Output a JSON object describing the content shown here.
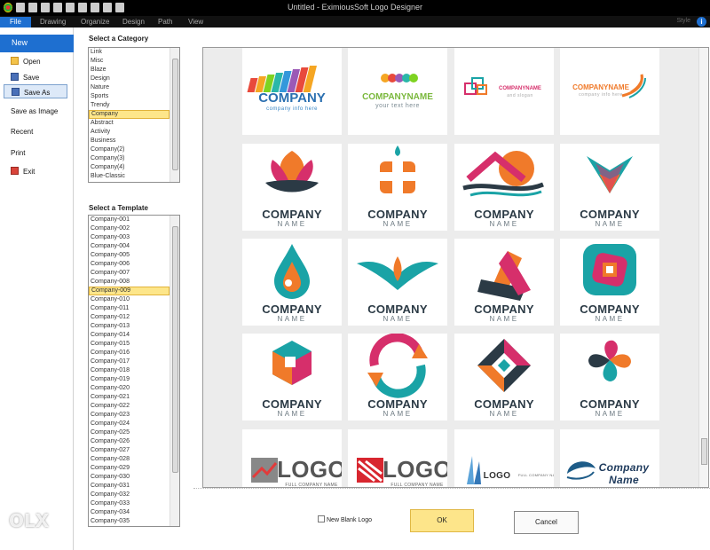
{
  "window": {
    "title": "Untitled - EximiousSoft Logo Designer"
  },
  "menu": {
    "tabs": [
      "File",
      "Drawing",
      "Organize",
      "Design",
      "Path",
      "View"
    ],
    "style": "Style",
    "help": "i"
  },
  "sidebar": {
    "new": "New",
    "items": [
      {
        "label": "Open",
        "icon": "folder-open-icon"
      },
      {
        "label": "Save",
        "icon": "save-disk-icon"
      },
      {
        "label": "Save As",
        "icon": "save-as-icon"
      },
      {
        "label": "Save as Image",
        "icon": ""
      },
      {
        "label": "Recent",
        "icon": ""
      },
      {
        "label": "Print",
        "icon": ""
      },
      {
        "label": "Exit",
        "icon": "exit-icon"
      }
    ]
  },
  "category": {
    "title": "Select a Category",
    "items": [
      "Link",
      "Misc",
      "Blaze",
      "Design",
      "Nature",
      "Sports",
      "Trendy",
      "Company",
      "Abstract",
      "Activity",
      "Business",
      "Company(2)",
      "Company(3)",
      "Company(4)",
      "Blue-Classic"
    ],
    "selected": "Company"
  },
  "template": {
    "title": "Select a Template",
    "items": [
      "Company-001",
      "Company-002",
      "Company-003",
      "Company-004",
      "Company-005",
      "Company-006",
      "Company-007",
      "Company-008",
      "Company-009",
      "Company-010",
      "Company-011",
      "Company-012",
      "Company-013",
      "Company-014",
      "Company-015",
      "Company-016",
      "Company-017",
      "Company-018",
      "Company-019",
      "Company-020",
      "Company-021",
      "Company-022",
      "Company-023",
      "Company-024",
      "Company-025",
      "Company-026",
      "Company-027",
      "Company-028",
      "Company-029",
      "Company-030",
      "Company-031",
      "Company-032",
      "Company-033",
      "Company-034",
      "Company-035"
    ],
    "selected": "Company-009"
  },
  "gallery": {
    "row1": [
      {
        "name": "COMPANY",
        "sub": "company info here"
      },
      {
        "name": "COMPANYNAME",
        "sub": "your text here"
      },
      {
        "name": "COMPANYNAME",
        "sub": "and slogan"
      },
      {
        "name": "COMPANYNAME",
        "sub": "company info here"
      }
    ],
    "company": "COMPANY",
    "name_label": "NAME",
    "row5": [
      {
        "name": "LOGO",
        "sub": "FULL COMPANY NAME"
      },
      {
        "name": "LOGO",
        "sub": "FULL COMPANY NAME"
      },
      {
        "name": "LOGO",
        "sub": "FULL COMPANY NAME"
      },
      {
        "name": "Company",
        "sub": "Name"
      }
    ]
  },
  "bottom": {
    "checkbox_label": "New Blank Logo",
    "ok": "OK",
    "cancel": "Cancel"
  },
  "watermark": "OLX",
  "colors": {
    "accent": "#1e6fd0",
    "selection": "#fde68a",
    "teal": "#1aa3a6",
    "orange": "#f07a2a",
    "magenta": "#d62f6b",
    "dark": "#2b3a45"
  }
}
